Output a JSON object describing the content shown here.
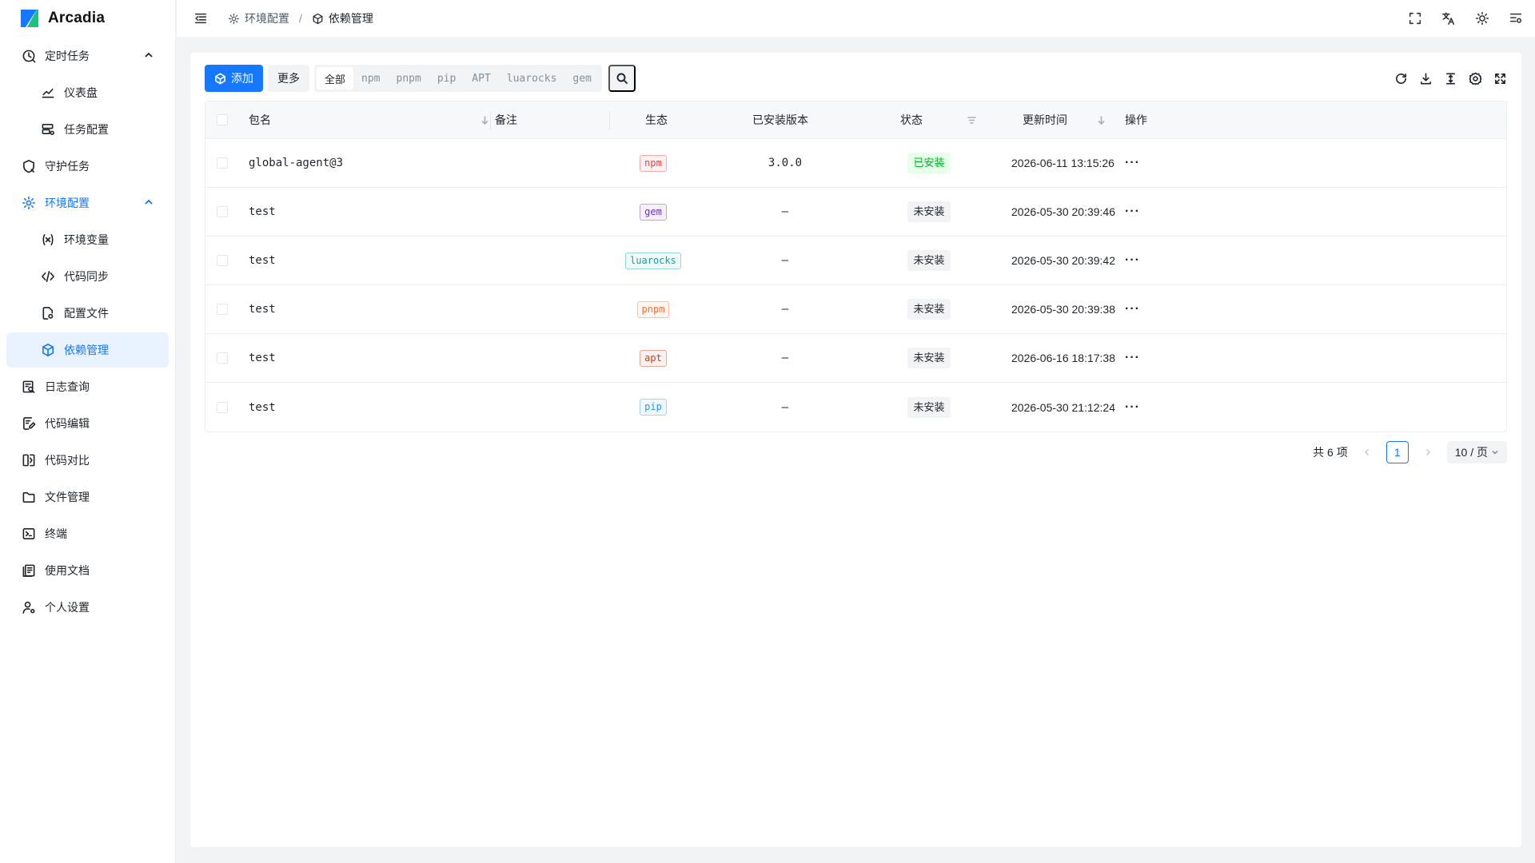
{
  "app": {
    "name": "Arcadia"
  },
  "sidebar": {
    "items": [
      {
        "label": "定时任务",
        "icon": "clock-icon",
        "expanded": true
      },
      {
        "label": "仪表盘",
        "icon": "chart-line-icon",
        "sub": true
      },
      {
        "label": "任务配置",
        "icon": "task-config-icon",
        "sub": true
      },
      {
        "label": "守护任务",
        "icon": "shield-icon"
      },
      {
        "label": "环境配置",
        "icon": "gear-icon",
        "expanded": true,
        "active_group": true
      },
      {
        "label": "环境变量",
        "icon": "variable-icon",
        "sub": true
      },
      {
        "label": "代码同步",
        "icon": "code-sync-icon",
        "sub": true
      },
      {
        "label": "配置文件",
        "icon": "config-file-icon",
        "sub": true
      },
      {
        "label": "依赖管理",
        "icon": "package-icon",
        "sub": true,
        "active": true
      },
      {
        "label": "日志查询",
        "icon": "log-search-icon"
      },
      {
        "label": "代码编辑",
        "icon": "code-edit-icon"
      },
      {
        "label": "代码对比",
        "icon": "code-compare-icon"
      },
      {
        "label": "文件管理",
        "icon": "folder-icon"
      },
      {
        "label": "终端",
        "icon": "terminal-icon"
      },
      {
        "label": "使用文档",
        "icon": "docs-icon"
      },
      {
        "label": "个人设置",
        "icon": "user-settings-icon"
      }
    ]
  },
  "header": {
    "breadcrumb": [
      {
        "label": "环境配置",
        "icon": "gear-icon"
      },
      {
        "label": "依赖管理",
        "icon": "package-icon"
      }
    ],
    "right_icons": [
      "fullscreen-icon",
      "translate-icon",
      "theme-sun-icon",
      "layout-settings-icon"
    ]
  },
  "toolbar": {
    "add_label": "添加",
    "more_label": "更多",
    "filters": [
      "全部",
      "npm",
      "pnpm",
      "pip",
      "APT",
      "luarocks",
      "gem"
    ],
    "active_filter": "全部",
    "right_icons": [
      "refresh-icon",
      "download-icon",
      "column-height-icon",
      "settings-icon",
      "expand-icon"
    ]
  },
  "table": {
    "headers": {
      "name": "包名",
      "remark": "备注",
      "ecosystem": "生态",
      "version": "已安装版本",
      "status": "状态",
      "updated": "更新时间",
      "action": "操作"
    },
    "rows": [
      {
        "name": "global-agent@3",
        "remark": "",
        "ecosystem": "npm",
        "version": "3.0.0",
        "status": "已安装",
        "updated": "2026-06-11 13:15:26",
        "action": "···"
      },
      {
        "name": "test",
        "remark": "",
        "ecosystem": "gem",
        "version": "–",
        "status": "未安装",
        "updated": "2026-05-30 20:39:46",
        "action": "···"
      },
      {
        "name": "test",
        "remark": "",
        "ecosystem": "luarocks",
        "version": "–",
        "status": "未安装",
        "updated": "2026-05-30 20:39:42",
        "action": "···"
      },
      {
        "name": "test",
        "remark": "",
        "ecosystem": "pnpm",
        "version": "–",
        "status": "未安装",
        "updated": "2026-05-30 20:39:38",
        "action": "···"
      },
      {
        "name": "test",
        "remark": "",
        "ecosystem": "apt",
        "version": "–",
        "status": "未安装",
        "updated": "2026-06-16 18:17:38",
        "action": "···"
      },
      {
        "name": "test",
        "remark": "",
        "ecosystem": "pip",
        "version": "–",
        "status": "未安装",
        "updated": "2026-05-30 21:12:24",
        "action": "···"
      }
    ]
  },
  "pagination": {
    "total_label": "共 6 项",
    "current_page": "1",
    "page_size_label": "10 / 页"
  },
  "colors": {
    "primary": "#1677ff",
    "npm": "#f53f3f",
    "gem": "#722ed1",
    "luarocks": "#0fa5a0",
    "pnpm": "#f77234",
    "apt": "#d4380d",
    "pip": "#3491fa",
    "installed": "#00b42a"
  }
}
